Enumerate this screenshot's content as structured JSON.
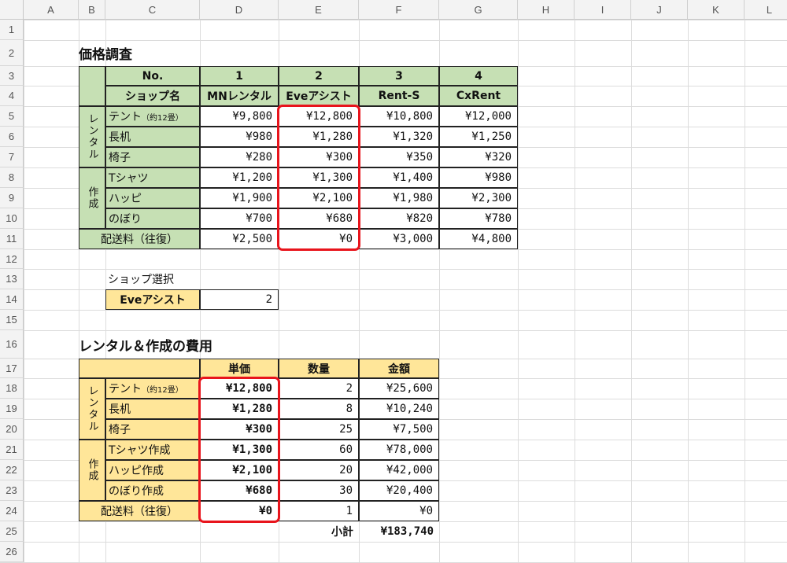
{
  "columns": [
    "A",
    "B",
    "C",
    "D",
    "E",
    "F",
    "G",
    "H",
    "I",
    "J",
    "K",
    "L"
  ],
  "rows": [
    "1",
    "2",
    "3",
    "4",
    "5",
    "6",
    "7",
    "8",
    "9",
    "10",
    "11",
    "12",
    "13",
    "14",
    "15",
    "16",
    "17",
    "18",
    "19",
    "20",
    "21",
    "22",
    "23",
    "24",
    "25",
    "26"
  ],
  "colors": {
    "green": "#c6e0b4",
    "orange": "#ffe699",
    "highlight": "#e8141c"
  },
  "survey": {
    "title": "価格調査",
    "no_label": "No.",
    "shop_label": "ショップ名",
    "numbers": [
      "1",
      "2",
      "3",
      "4"
    ],
    "shops": [
      "MNレンタル",
      "Eveアシスト",
      "Rent-S",
      "CxRent"
    ],
    "group_rental": "レンタル",
    "group_make": "作成",
    "items": [
      {
        "name": "テント",
        "note": "（約12畳）",
        "values": [
          "¥9,800",
          "¥12,800",
          "¥10,800",
          "¥12,000"
        ]
      },
      {
        "name": "長机",
        "note": "",
        "values": [
          "¥980",
          "¥1,280",
          "¥1,320",
          "¥1,250"
        ]
      },
      {
        "name": "椅子",
        "note": "",
        "values": [
          "¥280",
          "¥300",
          "¥350",
          "¥320"
        ]
      },
      {
        "name": "Tシャツ",
        "note": "",
        "values": [
          "¥1,200",
          "¥1,300",
          "¥1,400",
          "¥980"
        ]
      },
      {
        "name": "ハッピ",
        "note": "",
        "values": [
          "¥1,900",
          "¥2,100",
          "¥1,980",
          "¥2,300"
        ]
      },
      {
        "name": "のぼり",
        "note": "",
        "values": [
          "¥700",
          "¥680",
          "¥820",
          "¥780"
        ]
      }
    ],
    "shipping": {
      "name": "配送料（往復）",
      "values": [
        "¥2,500",
        "¥0",
        "¥3,000",
        "¥4,800"
      ]
    }
  },
  "select": {
    "label": "ショップ選択",
    "shop": "Eveアシスト",
    "value": "2"
  },
  "cost": {
    "title": "レンタル＆作成の費用",
    "headers": [
      "単価",
      "数量",
      "金額"
    ],
    "group_rental": "レンタル",
    "group_make": "作成",
    "items": [
      {
        "name": "テント",
        "note": "（約12畳）",
        "price": "¥12,800",
        "qty": "2",
        "amount": "¥25,600"
      },
      {
        "name": "長机",
        "note": "",
        "price": "¥1,280",
        "qty": "8",
        "amount": "¥10,240"
      },
      {
        "name": "椅子",
        "note": "",
        "price": "¥300",
        "qty": "25",
        "amount": "¥7,500"
      },
      {
        "name": "Tシャツ作成",
        "note": "",
        "price": "¥1,300",
        "qty": "60",
        "amount": "¥78,000"
      },
      {
        "name": "ハッピ作成",
        "note": "",
        "price": "¥2,100",
        "qty": "20",
        "amount": "¥42,000"
      },
      {
        "name": "のぼり作成",
        "note": "",
        "price": "¥680",
        "qty": "30",
        "amount": "¥20,400"
      }
    ],
    "shipping": {
      "name": "配送料（往復）",
      "price": "¥0",
      "qty": "1",
      "amount": "¥0"
    },
    "subtotal_label": "小計",
    "subtotal": "¥183,740"
  }
}
